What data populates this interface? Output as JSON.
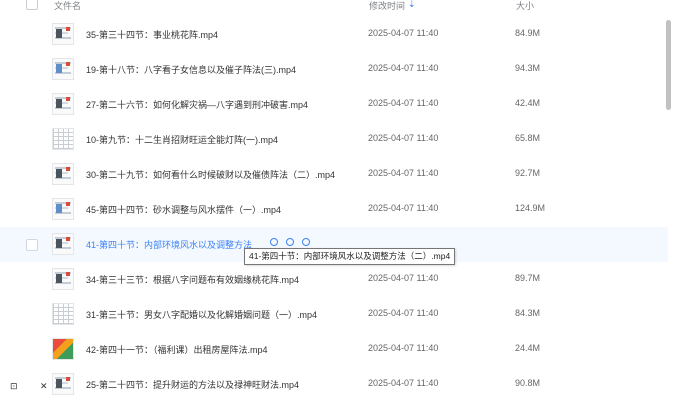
{
  "header": {
    "name_label": "文件名",
    "time_label": "修改时间",
    "size_label": "大小",
    "sort_icon": "sort-down-icon"
  },
  "rows": [
    {
      "name": "35-第三十四节：事业桃花阵.mp4",
      "time": "2025-04-07 11:40",
      "size": "84.9M",
      "thumb": "dark"
    },
    {
      "name": "19-第十八节：八字看子女信息以及催子阵法(三).mp4",
      "time": "2025-04-07 11:40",
      "size": "94.3M",
      "thumb": "blue"
    },
    {
      "name": "27-第二十六节：如何化解灾祸—八字遇到刑冲破害.mp4",
      "time": "2025-04-07 11:40",
      "size": "42.4M",
      "thumb": "dark"
    },
    {
      "name": "10-第九节：十二生肖招财旺运全能灯阵(一).mp4",
      "time": "2025-04-07 11:40",
      "size": "65.8M",
      "thumb": "grid"
    },
    {
      "name": "30-第二十九节：如何看什么时候破财以及催债阵法（二）.mp4",
      "time": "2025-04-07 11:40",
      "size": "92.7M",
      "thumb": "dark"
    },
    {
      "name": "45-第四十四节：砂水调整与风水摆件（一）.mp4",
      "time": "2025-04-07 11:40",
      "size": "124.9M",
      "thumb": "blue"
    },
    {
      "name": "41-第四十节：内部环境风水以及调整方法",
      "time": "",
      "size": "",
      "thumb": "dark",
      "hover": true
    },
    {
      "name": "34-第三十三节：根据八字问题布有效姻缘桃花阵.mp4",
      "time": "2025-04-07 11:40",
      "size": "89.7M",
      "thumb": "dark"
    },
    {
      "name": "31-第三十节：男女八字配婚以及化解婚姻问题（一）.mp4",
      "time": "2025-04-07 11:40",
      "size": "84.3M",
      "thumb": "grid"
    },
    {
      "name": "42-第四十一节：（福利课）出租房屋阵法.mp4",
      "time": "2025-04-07 11:40",
      "size": "24.4M",
      "thumb": "color"
    },
    {
      "name": "25-第二十四节：提升财运的方法以及禄神旺财法.mp4",
      "time": "2025-04-07 11:40",
      "size": "90.8M",
      "thumb": "dark"
    }
  ],
  "tooltip": "41-第四十节：内部环境风水以及调整方法（二）.mp4",
  "bottom": {
    "left_glyph": "⊡",
    "close_glyph": "✕"
  }
}
